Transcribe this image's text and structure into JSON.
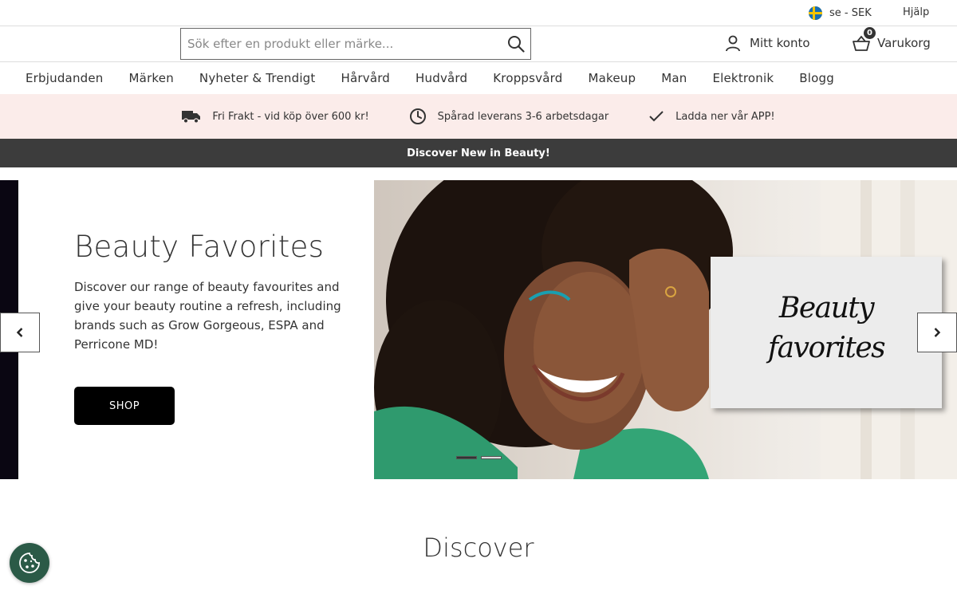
{
  "utility": {
    "locale": "se - SEK",
    "help": "Hjälp"
  },
  "header": {
    "search_placeholder": "Sök efter en produkt eller märke...",
    "account_label": "Mitt konto",
    "cart_label": "Varukorg",
    "cart_count": "0"
  },
  "nav": {
    "items": [
      "Erbjudanden",
      "Märken",
      "Nyheter & Trendigt",
      "Hårvård",
      "Hudvård",
      "Kroppsvård",
      "Makeup",
      "Man",
      "Elektronik",
      "Blogg"
    ]
  },
  "benefits": [
    {
      "icon": "truck-icon",
      "text": "Fri Frakt - vid köp över 600 kr!"
    },
    {
      "icon": "clock-icon",
      "text": "Spårad leverans 3-6 arbetsdagar"
    },
    {
      "icon": "checkmark-icon",
      "text": "Ladda ner vår APP!"
    }
  ],
  "announcement": "Discover New in Beauty!",
  "hero": {
    "title": "Beauty Favorites",
    "description": "Discover our range of beauty favourites and give your beauty routine a refresh, including brands such as Grow Gorgeous, ESPA and Perricone MD!",
    "button": "SHOP",
    "card_line1": "Beauty",
    "card_line2": "favorites",
    "slide_count": 2,
    "active_slide": 0
  },
  "discover_title": "Discover",
  "colors": {
    "benefit_bg": "#fbecea",
    "announce_bg": "#3c3c3c",
    "cookie_bg": "#2b5a47"
  }
}
